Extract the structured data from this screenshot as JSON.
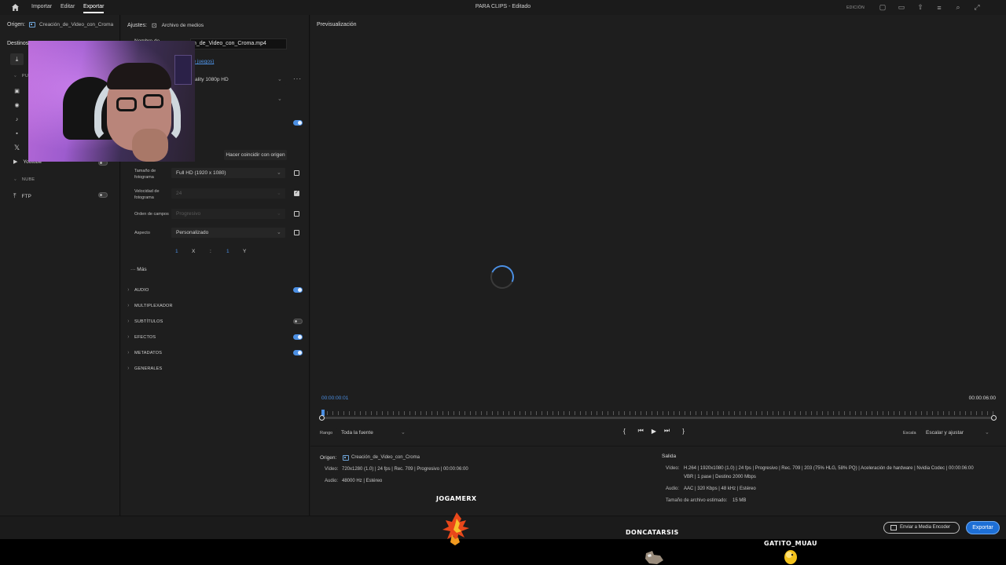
{
  "topbar": {
    "nav": [
      "Importar",
      "Editar",
      "Exportar"
    ],
    "title": "PARA CLIPS",
    "title_suffix": " - Editado",
    "edition_label": "EDICIÓN"
  },
  "left_panel": {
    "origin_label": "Origen:",
    "origin_file": "Creación_de_Video_con_Croma",
    "destinations_label": "Destinos",
    "section_publish": "PU",
    "section_cloud": "NUBE",
    "youtube_label": "Youtube",
    "ftp_label": "FTP",
    "social_icons": [
      "facebook-square-icon",
      "facebook-icon",
      "tiktok-icon",
      "vimeo-icon",
      "x-icon",
      "youtube-icon"
    ]
  },
  "settings": {
    "label": "Ajustes:",
    "media_file_label": "Archivo de medios",
    "name_label": "Nombre de",
    "filename": "n_de_Video_con_Croma.mp4",
    "location_link": "de juegos)",
    "preset_value": "ality 1080p HD",
    "more_label": "···",
    "match_source_button": "Hacer coincidir con origen",
    "frame_size_label": "Tamaño de fotograma",
    "frame_size_value": "Full HD (1920 x 1080)",
    "frame_rate_label": "Velocidad de fotograma",
    "frame_rate_value": "24",
    "field_order_label": "Orden de campos",
    "field_order_value": "Progresivo",
    "aspect_label": "Aspecto",
    "aspect_value": "Personalizado",
    "aspect_num1": "1",
    "aspect_x": "X",
    "aspect_sep": ":",
    "aspect_num2": "1",
    "aspect_y": "Y",
    "mas_label": "··· Más",
    "accordions": [
      {
        "label": "AUDIO",
        "toggle": "on"
      },
      {
        "label": "MULTIPLEXADOR",
        "toggle": "none"
      },
      {
        "label": "SUBTÍTULOS",
        "toggle": "off"
      },
      {
        "label": "EFECTOS",
        "toggle": "on"
      },
      {
        "label": "METADATOS",
        "toggle": "on"
      },
      {
        "label": "GENERALES",
        "toggle": "none"
      }
    ]
  },
  "preview": {
    "title": "Previsualización",
    "timecode_start": "00:00:00:01",
    "timecode_end": "00:00:06:00",
    "range_label": "Rango",
    "range_value": "Toda la fuente",
    "scale_label": "Escala",
    "scale_value": "Escalar y ajustar",
    "transport": [
      "{",
      "⏮",
      "▶",
      "⏭",
      "}"
    ]
  },
  "summary": {
    "origin_label": "Origen:",
    "origin_file": "Creación_de_Video_con_Croma",
    "src_video_label": "Vídeo:",
    "src_video_value": "720x1280 (1.0)  |  24 fps  |  Rec. 709  |  Progresivo  |  00:00:06:00",
    "src_audio_label": "Audio:",
    "src_audio_value": "48000 Hz  |  Estéreo",
    "output_label": "Salida",
    "out_video_label": "Vídeo:",
    "out_video_value1": "H.264  |  1920x1080 (1.0)  |  24 fps  |  Progresivo  |  Rec. 709  |  203 (75% HLG, 58% PQ)  |  Aceleración de hardware  |  Nvidia Codec  |  00:00:06:00",
    "out_video_value2": "VBR  |  1 pase  |  Destino 2000 Mbps",
    "out_audio_label": "Audio:",
    "out_audio_value": "AAC  |  320 Kbps  |  48 kHz  |  Estéreo",
    "size_label": "Tamaño de archivo estimado:",
    "size_value": "15 MB"
  },
  "bottom": {
    "encoder_button": "Enviar a Media Encoder",
    "export_button": "Exportar"
  },
  "overlay": {
    "names": [
      "JOGAMERX",
      "DONCATARSIS",
      "GATITO_MUAU"
    ]
  },
  "colors": {
    "accent": "#4b8fe3",
    "export_button": "#1d6fd6",
    "background": "#1e1e1e"
  }
}
